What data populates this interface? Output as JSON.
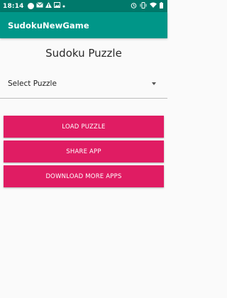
{
  "status_bar": {
    "time": "18:14",
    "left_icons": [
      "notification-dot-icon",
      "mail-icon",
      "alert-icon",
      "gallery-icon",
      "dot-small-icon"
    ],
    "right_icons": [
      "alarm-icon",
      "vibrate-icon",
      "wifi-icon",
      "battery-icon"
    ]
  },
  "app_bar": {
    "title": "SudokuNewGame"
  },
  "main": {
    "heading": "Sudoku Puzzle",
    "select": {
      "value": "Select Puzzle"
    },
    "buttons": {
      "load": "LOAD PUZZLE",
      "share": "SHARE APP",
      "download": "DOWNLOAD MORE APPS"
    }
  },
  "colors": {
    "status_bar": "#00796b",
    "app_bar": "#009688",
    "button": "#e01c63",
    "background": "#fafafa"
  }
}
